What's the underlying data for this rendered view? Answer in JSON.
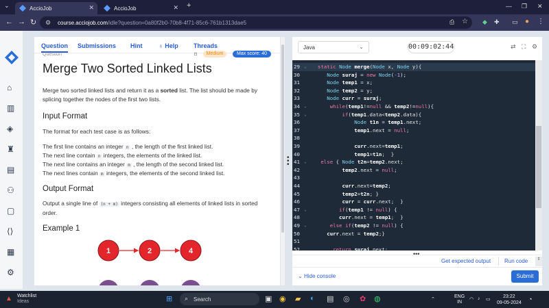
{
  "browser": {
    "tabs": [
      {
        "label": "AccioJob",
        "active": true
      },
      {
        "label": "AccioJob",
        "active": false
      }
    ],
    "url_host": "course.acciojob.com",
    "url_path": "/idle?question=0a80f2b0-70b8-4f71-85c6-761b1313dae5"
  },
  "left_tabs": [
    "Question",
    "Submissions",
    "Hint",
    "Help",
    "Threads"
  ],
  "question": {
    "label": "Question",
    "difficulty": "Medium",
    "max_score": "Max score: 40",
    "title": "Merge Two Sorted Linked Lists",
    "desc_before": "Merge two sorted linked lists and return it as a ",
    "desc_bold": "sorted",
    "desc_after": " list. The list should be made by splicing together the nodes of the first two lists.",
    "input_heading": "Input Format",
    "input_intro": "The format for each test case is as follows:",
    "line1_a": "The first line contains an integer ",
    "line1_code": "n",
    "line1_b": " , the length of the first linked list.",
    "line2_a": "The next line contain ",
    "line2_code": "n",
    "line2_b": " integers, the elements of the linked list.",
    "line3_a": "The next line contains an integer ",
    "line3_code": "m",
    "line3_b": " , the length of the second linked list.",
    "line4_a": "The next lines contain ",
    "line4_code": "m",
    "line4_b": " integers, the elements of the second linked list.",
    "output_heading": "Output Format",
    "output_a": "Output a single line of ",
    "output_code": "(n + m)",
    "output_b": " integers consisting all elements of linked lists in sorted order.",
    "example_heading": "Example 1",
    "example_nodes": [
      "1",
      "2",
      "4"
    ]
  },
  "editor": {
    "language": "Java",
    "timer": "00:09:02:44",
    "lines": [
      {
        "n": "29",
        "fold": true,
        "text": "  static Node merge(Node x, Node y){"
      },
      {
        "n": "30",
        "fold": false,
        "text": "     Node suraj = new Node(-1);"
      },
      {
        "n": "31",
        "fold": false,
        "text": "     Node temp1 = x;"
      },
      {
        "n": "32",
        "fold": false,
        "text": "     Node temp2 = y;"
      },
      {
        "n": "33",
        "fold": false,
        "text": "     Node curr = suraj;"
      },
      {
        "n": "34",
        "fold": true,
        "text": "      while(temp1!=null && temp2!=null){"
      },
      {
        "n": "35",
        "fold": true,
        "text": "          if(temp1.data<temp2.data){"
      },
      {
        "n": "36",
        "fold": false,
        "text": "              Node t1n = temp1.next;"
      },
      {
        "n": "37",
        "fold": false,
        "text": "              temp1.next = null;"
      },
      {
        "n": "38",
        "fold": false,
        "text": ""
      },
      {
        "n": "39",
        "fold": false,
        "text": "              curr.next=temp1;"
      },
      {
        "n": "40",
        "fold": false,
        "text": "              temp1=t1n;  }"
      },
      {
        "n": "41",
        "fold": true,
        "text": "   else { Node t2n=temp2.next;"
      },
      {
        "n": "42",
        "fold": false,
        "text": "          temp2.next = null;"
      },
      {
        "n": "43",
        "fold": false,
        "text": ""
      },
      {
        "n": "44",
        "fold": false,
        "text": "          curr.next=temp2;"
      },
      {
        "n": "45",
        "fold": false,
        "text": "          temp2=t2n; }"
      },
      {
        "n": "46",
        "fold": false,
        "text": "          curr = curr.next;  }"
      },
      {
        "n": "47",
        "fold": true,
        "text": "         if(temp1 != null) {"
      },
      {
        "n": "48",
        "fold": false,
        "text": "         curr.next = temp1;  }"
      },
      {
        "n": "49",
        "fold": true,
        "text": "      else if(temp2 != null) {"
      },
      {
        "n": "50",
        "fold": false,
        "text": "     curr.next = temp2;}"
      },
      {
        "n": "51",
        "fold": false,
        "text": ""
      },
      {
        "n": "52",
        "fold": false,
        "text": "       return suraj.next;"
      }
    ],
    "get_expected_output": "Get expected output",
    "run_code": "Run code",
    "hide_console": "Hide console",
    "submit": "Submit"
  },
  "taskbar": {
    "weather_title": "Watchlist",
    "weather_sub": "Ideas",
    "search": "Search",
    "lang_top": "ENG",
    "lang_bottom": "IN",
    "time": "23:22",
    "date": "09-05-2024"
  },
  "colors": {
    "accent": "#2a6dd7",
    "editor_bg": "#1e2a38",
    "node_red": "#e3262b"
  }
}
